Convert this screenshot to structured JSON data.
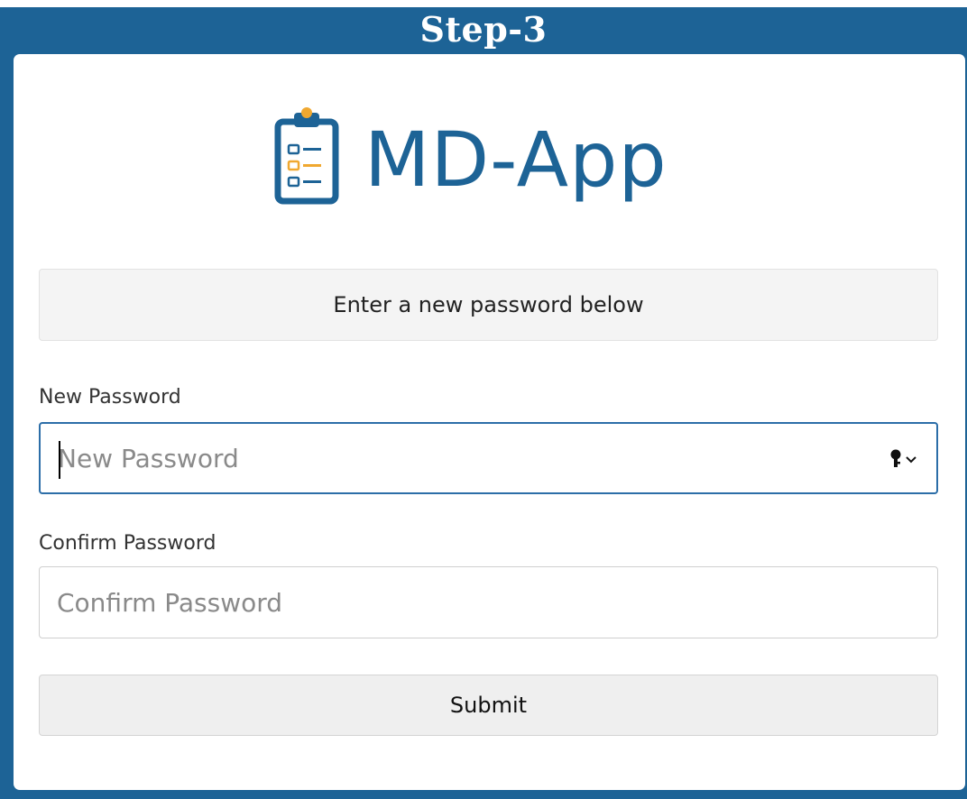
{
  "header": {
    "step_title": "Step-3"
  },
  "logo": {
    "app_name": "MD-App",
    "icon": "clipboard-checklist-icon",
    "brand_color": "#1d6396",
    "accent_color": "#f0a830"
  },
  "form": {
    "notice": "Enter a new password below",
    "new_password": {
      "label": "New Password",
      "placeholder": "New Password",
      "value": "",
      "icon": "password-key-dropdown-icon"
    },
    "confirm_password": {
      "label": "Confirm Password",
      "placeholder": "Confirm Password",
      "value": ""
    },
    "submit_label": "Submit"
  }
}
